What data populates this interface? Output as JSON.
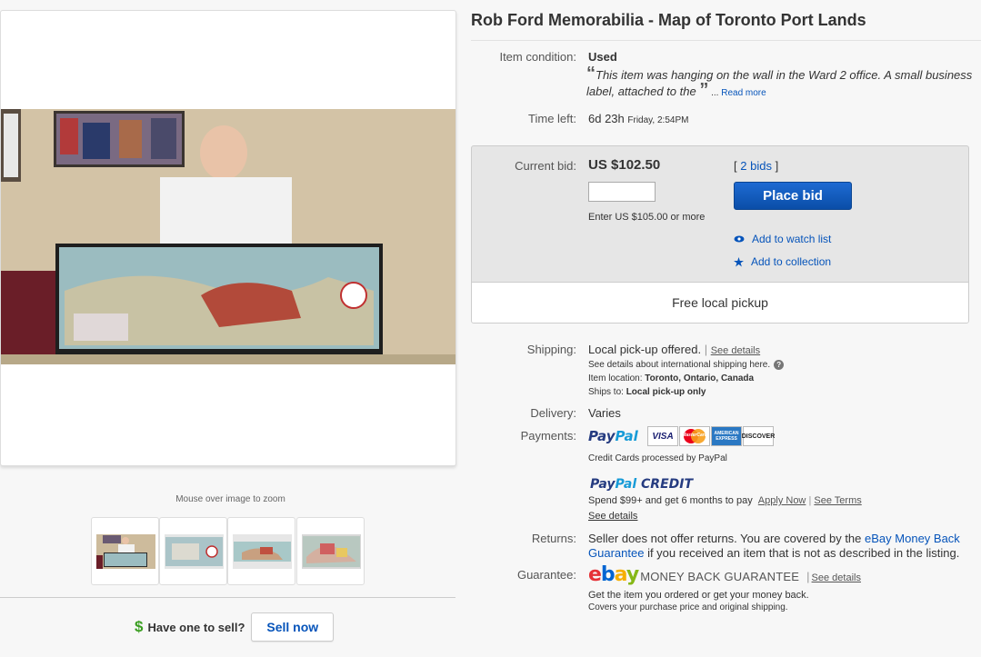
{
  "listing": {
    "title": "Rob Ford Memorabilia - Map of Toronto Port Lands"
  },
  "gallery": {
    "zoom_hint": "Mouse over image to zoom",
    "thumbnails": [
      "thumbnail-1",
      "thumbnail-2",
      "thumbnail-3",
      "thumbnail-4"
    ]
  },
  "sell": {
    "question": "Have one to sell?",
    "button": "Sell now"
  },
  "condition": {
    "label": "Item condition:",
    "value": "Used",
    "open_quote": "“",
    "quote": "This item was hanging on the wall in the Ward 2 office. A small business label, attached to the",
    "close_quote": "”",
    "ellipsis": " ... ",
    "read_more": "Read more"
  },
  "time": {
    "label": "Time left:",
    "value": "6d 23h",
    "end": "Friday, 2:54PM"
  },
  "bid": {
    "label": "Current bid:",
    "value": "US $102.50",
    "bids_open": "[",
    "bids_link": "2 bids",
    "bids_close": "]",
    "input_value": "",
    "enter_text": "Enter US $105.00 or more",
    "place_bid": "Place bid",
    "watch": "Add to watch list",
    "collection": "Add to collection",
    "pickup_banner": "Free local pickup"
  },
  "shipping": {
    "label": "Shipping:",
    "value": "Local pick-up offered.",
    "sep": "|",
    "see_details": "See details",
    "intl": "See details about international shipping here.",
    "location_label": "Item location:",
    "location": "Toronto, Ontario, Canada",
    "ships_label": "Ships to:",
    "ships": "Local pick-up only"
  },
  "delivery": {
    "label": "Delivery:",
    "value": "Varies"
  },
  "payments": {
    "label": "Payments:",
    "paypal_pay": "Pay",
    "paypal_pal": "Pal",
    "cards": [
      "VISA",
      "MasterCard",
      "AMERICAN EXPRESS",
      "DISCOVER"
    ],
    "processed": "Credit Cards processed by PayPal",
    "credit_pay": "Pay",
    "credit_pal": "Pal",
    "credit_word": "CREDIT",
    "credit_offer": "Spend $99+ and get 6 months to pay",
    "apply_now": "Apply Now",
    "sep": "|",
    "see_terms": "See Terms",
    "see_details": "See details"
  },
  "returns": {
    "label": "Returns:",
    "text1": "Seller does not offer returns. You are covered by the",
    "link": "eBay Money Back Guarantee",
    "text2": "if you received an item that is not as described in the listing."
  },
  "guarantee": {
    "label": "Guarantee:",
    "e": "e",
    "b": "b",
    "a": "a",
    "y": "y",
    "mbg": "MONEY BACK GUARANTEE",
    "sep": "|",
    "see_details": "See details",
    "line1": "Get the item you ordered or get your money back.",
    "line2": "Covers your purchase price and original shipping."
  },
  "colors": {
    "link": "#0654ba",
    "place_bid": "#1a5fc8",
    "paypal_dark": "#253b80",
    "paypal_light": "#179bd7",
    "ebay_red": "#e53238",
    "ebay_blue": "#0064d2",
    "ebay_yellow": "#f5af02",
    "ebay_green": "#86b817",
    "sell_dollar": "#3a9e21"
  }
}
